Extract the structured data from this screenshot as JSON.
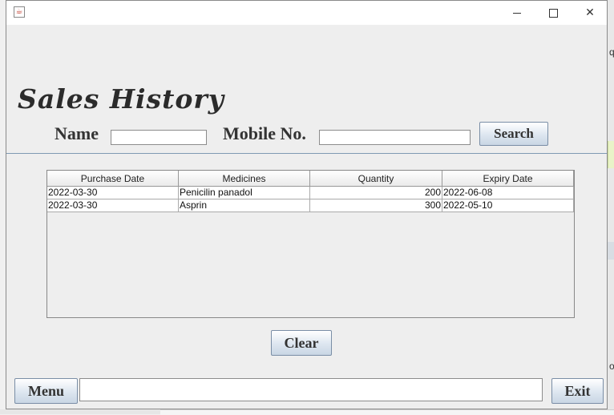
{
  "window": {
    "title": "",
    "app_icon": "java-cup-icon",
    "controls": {
      "minimize": "minimize-icon",
      "maximize": "maximize-icon",
      "close": "close-icon"
    }
  },
  "page": {
    "heading": "Sales History"
  },
  "search": {
    "name_label": "Name",
    "name_value": "",
    "mobile_label": "Mobile No.",
    "mobile_value": "",
    "search_button": "Search"
  },
  "table": {
    "columns": [
      "Purchase Date",
      "Medicines",
      "Quantity",
      "Expiry Date"
    ],
    "rows": [
      [
        "2022-03-30",
        "Penicilin panadol",
        "200",
        "2022-06-08"
      ],
      [
        "2022-03-30",
        "Asprin",
        "300",
        "2022-05-10"
      ]
    ]
  },
  "actions": {
    "clear_button": "Clear",
    "menu_button": "Menu",
    "status_value": "",
    "exit_button": "Exit"
  },
  "background": {
    "fragments": [
      "q",
      "ol"
    ]
  },
  "colors": {
    "button_gradient_end": "#c9d6e4",
    "separator": "#7f9ab3",
    "window_bg": "#eeeeee"
  }
}
